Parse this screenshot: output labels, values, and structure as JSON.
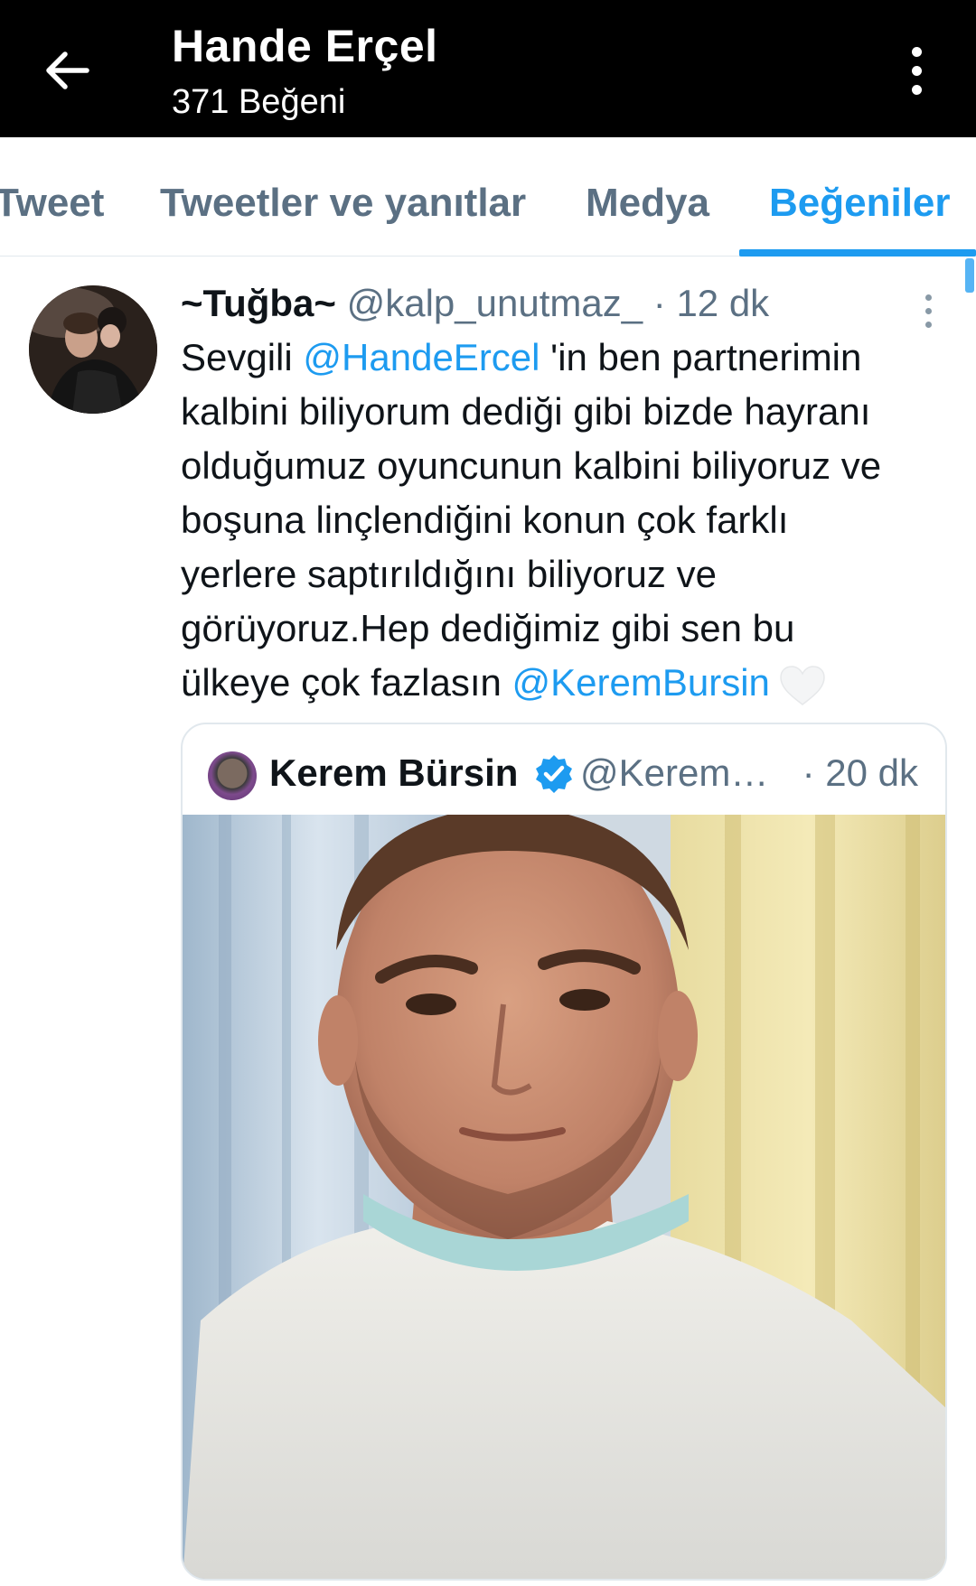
{
  "header": {
    "title": "Hande Erçel",
    "subtitle": "371 Beğeni"
  },
  "tabs": [
    {
      "label": "Tweet",
      "active": false
    },
    {
      "label": "Tweetler ve yanıtlar",
      "active": false
    },
    {
      "label": "Medya",
      "active": false
    },
    {
      "label": "Beğeniler",
      "active": true
    }
  ],
  "tweet": {
    "author_name": "~Tuğba~",
    "author_handle": "@kalp_unutmaz_",
    "separator": "·",
    "time": "12 dk",
    "lines": [
      {
        "pre": "Sevgili ",
        "mention": "@HandeErcel",
        "post": " 'in ben partnerimin"
      },
      {
        "text": "kalbini biliyorum dediği gibi bizde hayranı"
      },
      {
        "text": "olduğumuz oyuncunun kalbini biliyoruz ve"
      },
      {
        "text": "boşuna linçlendiğini konun çok farklı"
      },
      {
        "text": "yerlere saptırıldığını biliyoruz ve"
      },
      {
        "text": "görüyoruz.Hep dediğimiz gibi sen bu"
      },
      {
        "pre": "ülkeye çok fazlasın ",
        "mention": "@KeremBursin",
        "post": ""
      }
    ],
    "emoji": "white-heart"
  },
  "quoted_tweet": {
    "author_name": "Kerem Bürsin",
    "verified": true,
    "author_handle": "@Kerem…",
    "time": "· 20 dk",
    "media": "photo"
  },
  "colors": {
    "header_bg": "#000000",
    "accent": "#1d9bf0",
    "secondary_text": "#5b7083",
    "primary_text": "#0f1419"
  },
  "icons": [
    "back-arrow-icon",
    "overflow-menu-icon",
    "tweet-more-icon",
    "verified-badge-icon",
    "white-heart-emoji"
  ]
}
